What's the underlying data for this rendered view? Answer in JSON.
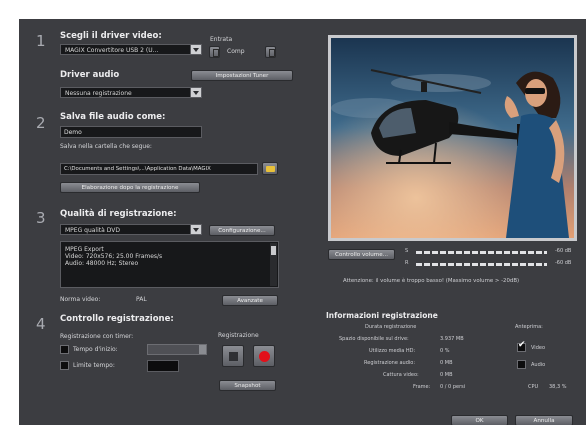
{
  "step1": {
    "number": "1",
    "title": "Scegli il driver video:",
    "driver_value": "MAGIX Convertitore USB 2 (U...",
    "entrata_label": "Entrata",
    "input_label": "Comp",
    "audio_title": "Driver audio",
    "tuner_button": "Impostazioni Tuner",
    "audio_value": "Nessuna registrazione"
  },
  "step2": {
    "number": "2",
    "title": "Salva file audio come:",
    "filename_value": "Demo",
    "folder_label": "Salva nella cartella che segue:",
    "folder_value": "C:\\Documents and Settings\\...\\Application Data\\MAGIX",
    "postprocess_button": "Elaborazione dopo la registrazione"
  },
  "step3": {
    "number": "3",
    "title": "Qualità di registrazione:",
    "quality_value": "MPEG qualità DVD",
    "config_button": "Configurazione...",
    "info_lines": [
      "MPEG Export",
      "Video: 720x576; 25.00 Frames/s",
      "Audio: 48000 Hz; Stereo"
    ],
    "norm_label": "Norma video:",
    "norm_value": "PAL",
    "advanced_button": "Avanzate"
  },
  "step4": {
    "number": "4",
    "title": "Controllo registrazione:",
    "timer_label": "Registrazione con timer:",
    "start_label": "Tempo d'inizio:",
    "limit_label": "Limite tempo:",
    "record_label": "Registrazione",
    "snapshot_button": "Snapshot"
  },
  "preview": {
    "volume_button": "Controllo volume...",
    "channels": [
      {
        "name": "S",
        "value": "-60 dB"
      },
      {
        "name": "R",
        "value": "-60 dB"
      }
    ],
    "warning": "Attenzione: il volume è troppo basso! (Massimo volume > -20dB)"
  },
  "info": {
    "title": "Informazioni registrazione",
    "rows": [
      {
        "label": "Durata registrazione",
        "value": ""
      },
      {
        "label": "Spazio disponibile sul drive:",
        "value": "3.937 MB"
      },
      {
        "label": "Utilizzo media HD:",
        "value": "0 %"
      },
      {
        "label": "Registrazione audio:",
        "value": "0 MB"
      },
      {
        "label": "Cattura video:",
        "value": "0 MB"
      },
      {
        "label": "Frame:",
        "value": "0 / 0 persi"
      }
    ],
    "anteprima_label": "Anteprima:",
    "video_label": "Video",
    "audio_label": "Audio",
    "cpu_label": "CPU",
    "cpu_value": "38,3 %"
  },
  "footer": {
    "ok_button": "OK",
    "cancel_button": "Annulla"
  },
  "colors": {
    "window_bg": "#3c3d41",
    "record_red": "#e2101a"
  }
}
